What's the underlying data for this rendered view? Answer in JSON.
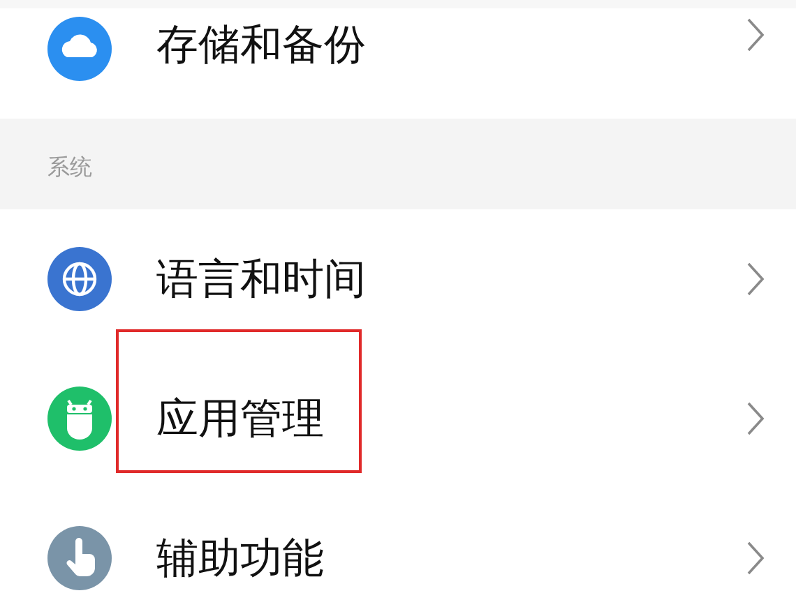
{
  "items_top": [
    {
      "label": "存储和备份",
      "kind": "cloud",
      "color": "#2b8ff0",
      "highlighted": false
    }
  ],
  "section": {
    "title": "系统"
  },
  "items": [
    {
      "label": "语言和时间",
      "kind": "globe",
      "color": "#3a74d0",
      "highlighted": false
    },
    {
      "label": "应用管理",
      "kind": "android",
      "color": "#1fbf6a",
      "highlighted": true
    },
    {
      "label": "辅助功能",
      "kind": "hand",
      "color": "#7a94a8",
      "highlighted": false
    }
  ]
}
